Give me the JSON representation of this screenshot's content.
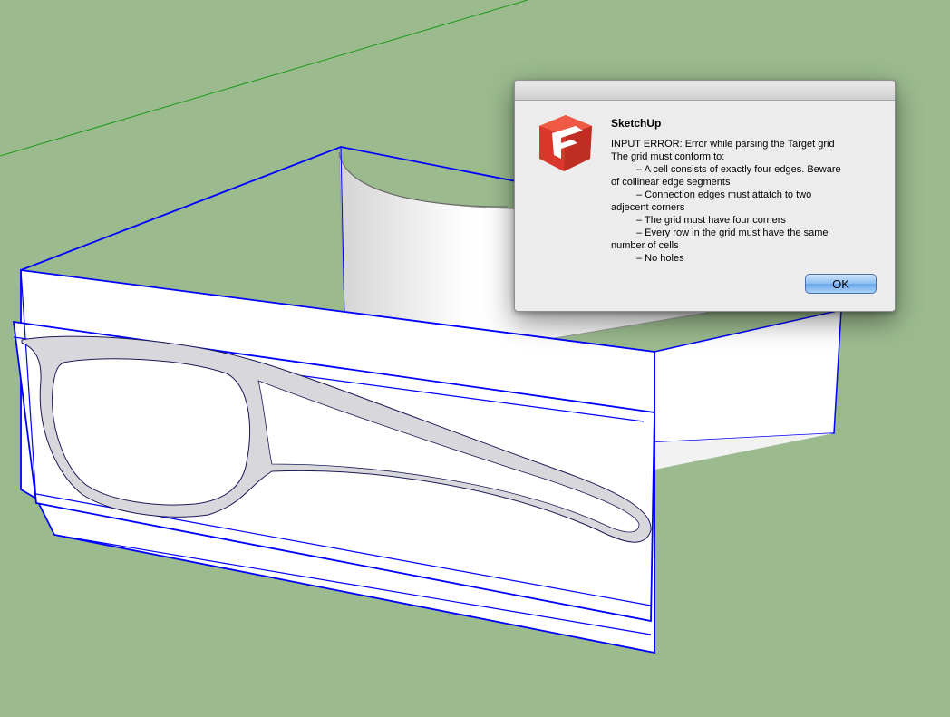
{
  "dialog": {
    "title": "SketchUp",
    "message_lines": [
      "INPUT ERROR: Error while parsing the Target grid",
      "The grid must conform to:",
      "– A cell consists of exactly four edges. Beware",
      "of collinear edge segments",
      "– Connection edges must attatch to two",
      "adjecent corners",
      "– The grid must have four corners",
      "– Every row in the grid must have the same",
      "number of cells",
      "– No holes"
    ],
    "ok_label": "OK"
  },
  "colors": {
    "background": "#9bbb8f",
    "edge_selection": "#0000ff",
    "axis_green": "#00aa00",
    "logo_red": "#e63a2e"
  }
}
